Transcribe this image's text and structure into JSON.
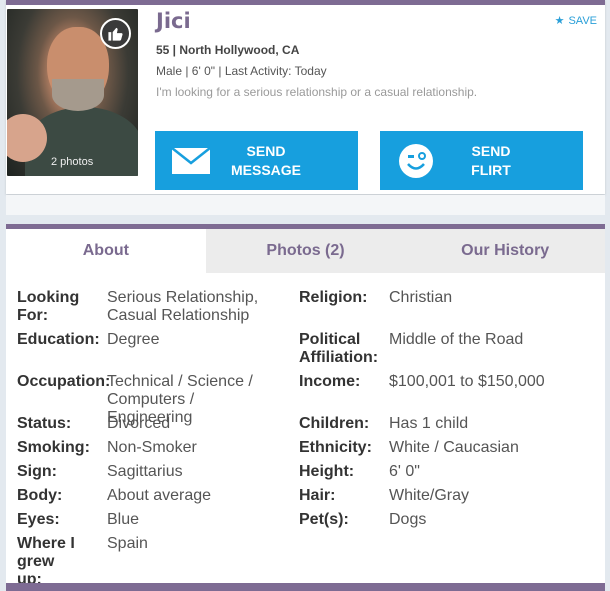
{
  "profile": {
    "name": "Jici",
    "save_label": "SAVE",
    "age_location": "55 | North Hollywood, CA",
    "details_line": "Male | 6' 0\" | Last Activity: Today",
    "tagline": "I'm looking for a serious relationship or a casual relationship.",
    "photo_count": "2 photos",
    "send_message": [
      "SEND",
      "MESSAGE"
    ],
    "send_flirt": [
      "SEND",
      "FLIRT"
    ]
  },
  "tabs": [
    {
      "label": "About",
      "active": true
    },
    {
      "label": "Photos (2)",
      "active": false
    },
    {
      "label": "Our History",
      "active": false
    }
  ],
  "about": {
    "left": [
      {
        "label": "Looking For:",
        "value": "Serious Relationship, Casual Relationship"
      },
      {
        "label": "Education:",
        "value": "Degree"
      },
      {
        "label": "Occupation:",
        "value": "Technical / Science / Computers / Engineering"
      },
      {
        "label": "Status:",
        "value": "Divorced"
      },
      {
        "label": "Smoking:",
        "value": "Non-Smoker"
      },
      {
        "label": "Sign:",
        "value": "Sagittarius"
      },
      {
        "label": "Body:",
        "value": "About average"
      },
      {
        "label": "Eyes:",
        "value": "Blue"
      },
      {
        "label": "Where I grew up:",
        "value": "Spain"
      }
    ],
    "right": [
      {
        "label": "Religion:",
        "value": "Christian"
      },
      {
        "label": "Political Affiliation:",
        "value": "Middle of the Road"
      },
      {
        "label": "Income:",
        "value": "$100,001 to $150,000"
      },
      {
        "label": "Children:",
        "value": "Has 1 child"
      },
      {
        "label": "Ethnicity:",
        "value": "White / Caucasian"
      },
      {
        "label": "Height:",
        "value": "6' 0\""
      },
      {
        "label": "Hair:",
        "value": "White/Gray"
      },
      {
        "label": "Pet(s):",
        "value": "Dogs"
      }
    ]
  },
  "colors": {
    "accent_purple": "#7e6b93",
    "button_blue": "#179fde",
    "save_blue": "#2a9fd8"
  }
}
